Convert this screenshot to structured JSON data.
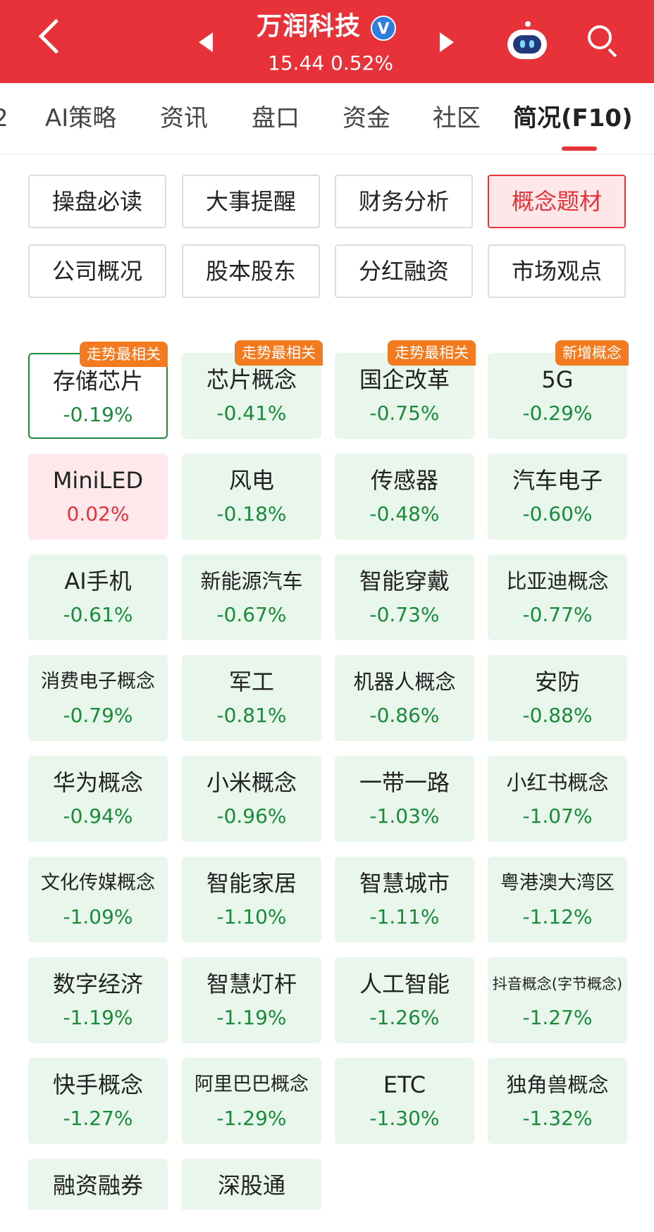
{
  "header": {
    "stock_name": "万润科技",
    "verified_mark": "V",
    "price_line": "15.44 0.52%",
    "colors": {
      "bg": "#e8323a",
      "verified": "#2f7de1"
    },
    "icons": [
      "back-arrow-icon",
      "prev-stock-icon",
      "next-stock-icon",
      "robot-assistant-icon",
      "search-icon"
    ]
  },
  "tabs": [
    {
      "label": "2"
    },
    {
      "label": "AI策略"
    },
    {
      "label": "资讯"
    },
    {
      "label": "盘口"
    },
    {
      "label": "资金"
    },
    {
      "label": "社区"
    },
    {
      "label": "简况(F10)",
      "active": true
    }
  ],
  "sub_tabs": [
    {
      "label": "操盘必读"
    },
    {
      "label": "大事提醒"
    },
    {
      "label": "财务分析"
    },
    {
      "label": "概念题材",
      "active": true
    },
    {
      "label": "公司概况"
    },
    {
      "label": "股本股东"
    },
    {
      "label": "分红融资"
    },
    {
      "label": "市场观点"
    }
  ],
  "concepts": [
    {
      "name": "存储芯片",
      "pct": "-0.19%",
      "tag": "走势最相关"
    },
    {
      "name": "芯片概念",
      "pct": "-0.41%",
      "tag": "走势最相关"
    },
    {
      "name": "国企改革",
      "pct": "-0.75%",
      "tag": "走势最相关"
    },
    {
      "name": "5G",
      "pct": "-0.29%",
      "tag": "新增概念"
    },
    {
      "name": "MiniLED",
      "pct": "0.02%"
    },
    {
      "name": "风电",
      "pct": "-0.18%"
    },
    {
      "name": "传感器",
      "pct": "-0.48%"
    },
    {
      "name": "汽车电子",
      "pct": "-0.60%"
    },
    {
      "name": "AI手机",
      "pct": "-0.61%"
    },
    {
      "name": "新能源汽车",
      "pct": "-0.67%"
    },
    {
      "name": "智能穿戴",
      "pct": "-0.73%"
    },
    {
      "name": "比亚迪概念",
      "pct": "-0.77%"
    },
    {
      "name": "消费电子概念",
      "pct": "-0.79%"
    },
    {
      "name": "军工",
      "pct": "-0.81%"
    },
    {
      "name": "机器人概念",
      "pct": "-0.86%"
    },
    {
      "name": "安防",
      "pct": "-0.88%"
    },
    {
      "name": "华为概念",
      "pct": "-0.94%"
    },
    {
      "name": "小米概念",
      "pct": "-0.96%"
    },
    {
      "name": "一带一路",
      "pct": "-1.03%"
    },
    {
      "name": "小红书概念",
      "pct": "-1.07%"
    },
    {
      "name": "文化传媒概念",
      "pct": "-1.09%"
    },
    {
      "name": "智能家居",
      "pct": "-1.10%"
    },
    {
      "name": "智慧城市",
      "pct": "-1.11%"
    },
    {
      "name": "粤港澳大湾区",
      "pct": "-1.12%"
    },
    {
      "name": "数字经济",
      "pct": "-1.19%"
    },
    {
      "name": "智慧灯杆",
      "pct": "-1.19%"
    },
    {
      "name": "人工智能",
      "pct": "-1.26%"
    },
    {
      "name": "抖音概念(字节概念)",
      "pct": "-1.27%"
    },
    {
      "name": "快手概念",
      "pct": "-1.27%"
    },
    {
      "name": "阿里巴巴概念",
      "pct": "-1.29%"
    },
    {
      "name": "ETC",
      "pct": "-1.30%"
    },
    {
      "name": "独角兽概念",
      "pct": "-1.32%"
    },
    {
      "name": "融资融券",
      "pct": ""
    },
    {
      "name": "深股通",
      "pct": ""
    }
  ],
  "colors": {
    "down_green": "#1a8a3a",
    "down_bg": "#e8f6ec",
    "up_red": "#e8323a",
    "up_bg": "#fde9ec",
    "tag_orange": "#f47a1f"
  }
}
